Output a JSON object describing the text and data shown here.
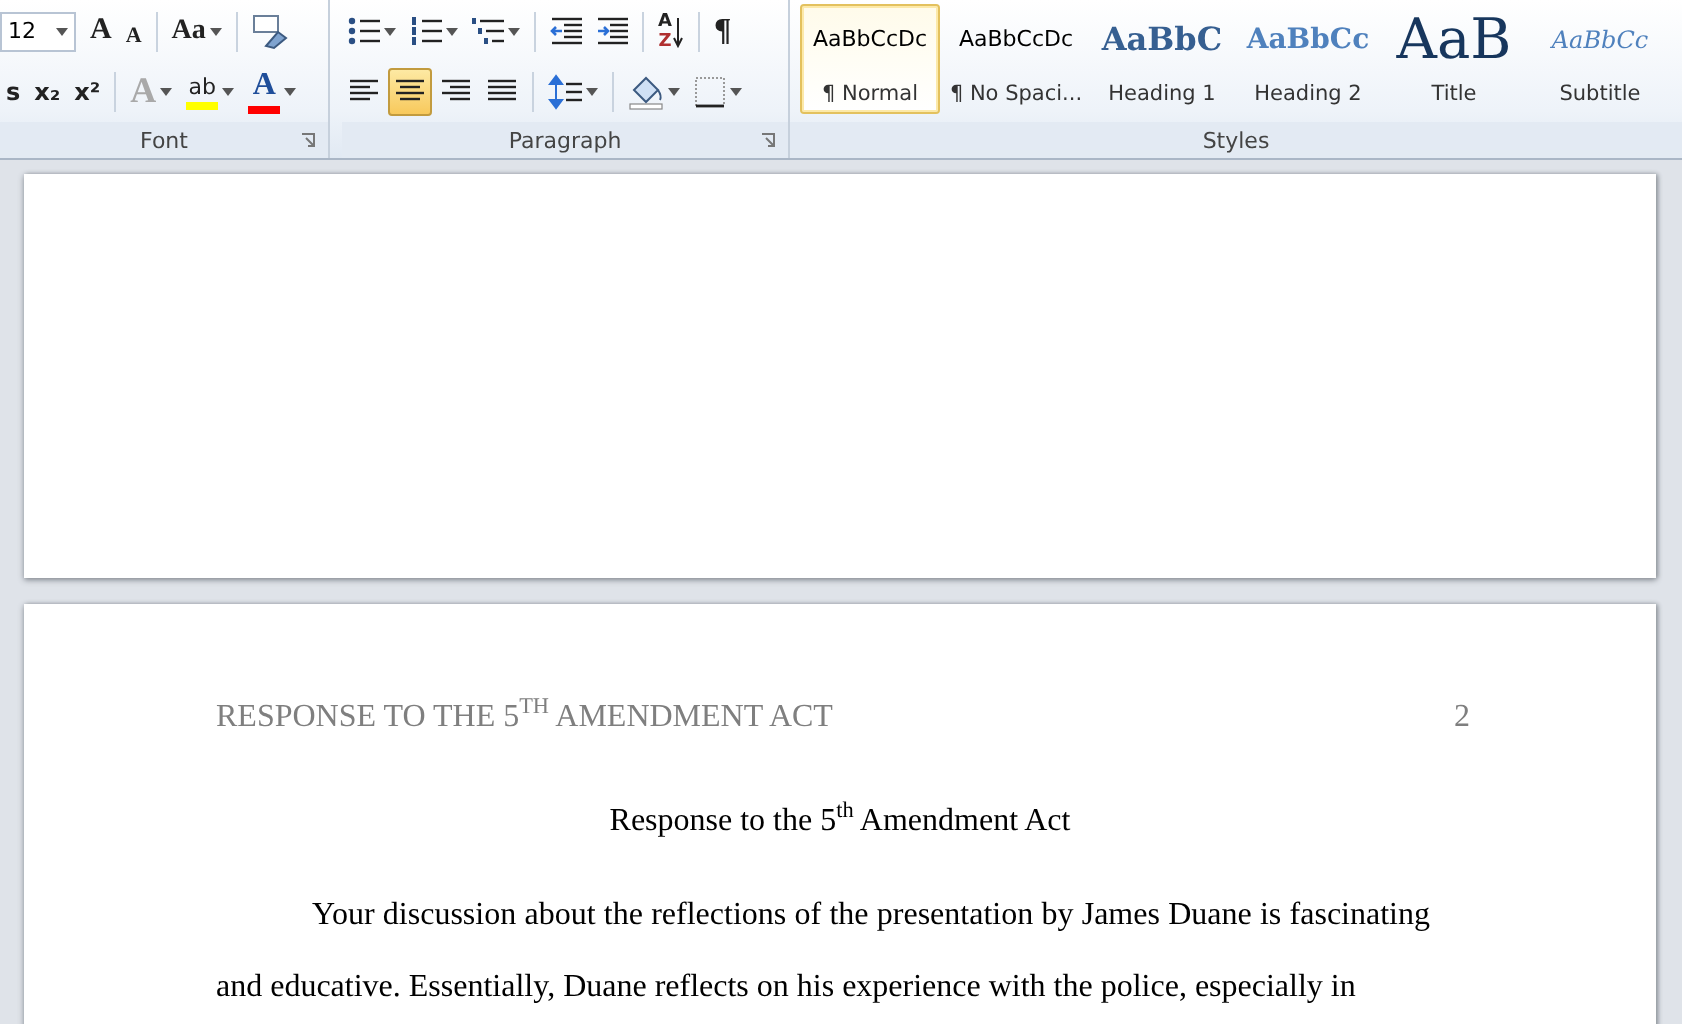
{
  "ribbon": {
    "groups": [
      {
        "label": "Font",
        "rows": [
          {
            "tools": [
              {
                "kind": "font-size",
                "value": "12"
              },
              {
                "kind": "grow",
                "glyph": "A"
              },
              {
                "kind": "shrink",
                "glyph": "A"
              },
              {
                "kind": "sep"
              },
              {
                "kind": "case",
                "glyph": "Aa"
              },
              {
                "kind": "sep"
              },
              {
                "kind": "clear"
              }
            ]
          },
          {
            "tools": [
              {
                "kind": "strike",
                "glyph": "s"
              },
              {
                "kind": "sub",
                "glyph": "x₂"
              },
              {
                "kind": "sup",
                "glyph": "x²"
              },
              {
                "kind": "sep"
              },
              {
                "kind": "effects",
                "glyph": "A"
              },
              {
                "kind": "highlight",
                "glyph": "ab"
              },
              {
                "kind": "color",
                "glyph": "A"
              }
            ]
          }
        ]
      },
      {
        "label": "Paragraph",
        "rows": [
          {
            "tools": [
              {
                "kind": "bullets"
              },
              {
                "kind": "numbering"
              },
              {
                "kind": "multilevel"
              },
              {
                "kind": "sep"
              },
              {
                "kind": "outdent"
              },
              {
                "kind": "indent"
              },
              {
                "kind": "sep"
              },
              {
                "kind": "sort",
                "glyph": "A",
                "glyph_bottom": "Z"
              },
              {
                "kind": "sep"
              },
              {
                "kind": "marks",
                "glyph": "¶"
              }
            ]
          },
          {
            "tools": [
              {
                "kind": "align-left",
                "selected": false
              },
              {
                "kind": "align-center",
                "selected": true
              },
              {
                "kind": "align-right",
                "selected": false
              },
              {
                "kind": "justify",
                "selected": false
              },
              {
                "kind": "sep"
              },
              {
                "kind": "spacing"
              },
              {
                "kind": "sep"
              },
              {
                "kind": "shading"
              },
              {
                "kind": "borders"
              }
            ]
          }
        ]
      }
    ],
    "styles": {
      "label": "Styles",
      "items": [
        {
          "preview": "AaBbCcDc",
          "label": "¶ Normal",
          "kind": "normal",
          "selected": true
        },
        {
          "preview": "AaBbCcDc",
          "label": "¶ No Spaci...",
          "kind": "normal",
          "selected": false
        },
        {
          "preview": "AaBbC",
          "label": "Heading 1",
          "kind": "heading1",
          "selected": false
        },
        {
          "preview": "AaBbCc",
          "label": "Heading 2",
          "kind": "heading2",
          "selected": false
        },
        {
          "preview": "AaB",
          "label": "Title",
          "kind": "title",
          "selected": false
        },
        {
          "preview": "AaBbCc",
          "label": "Subtitle",
          "kind": "subtitle",
          "selected": false
        }
      ]
    }
  },
  "document": {
    "pages": [
      {
        "kind": "blank"
      },
      {
        "kind": "text",
        "header": "RESPONSE TO THE 5$^{TH}$ AMENDMENT ACT",
        "page_number": "2",
        "title": "Response to the 5$^{th}$ Amendment Act",
        "paragraphs": [
          "Your discussion about the reflections of the presentation by James Duane is fascinating and educative. Essentially, Duane reflects on his experience with the police, especially in"
        ]
      }
    ]
  }
}
